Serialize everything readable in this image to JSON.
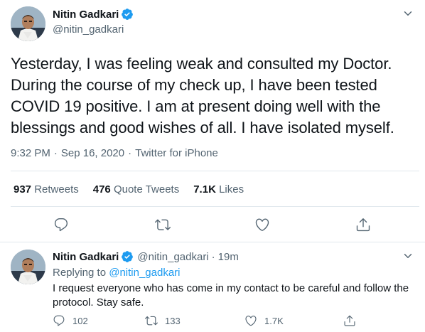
{
  "colors": {
    "accent": "#1d9bf0",
    "text_primary": "#0f1419",
    "text_secondary": "#536471",
    "divider": "#e1e8ed"
  },
  "main_tweet": {
    "author_name": "Nitin Gadkari",
    "handle": "@nitin_gadkari",
    "text": "Yesterday, I was feeling weak and consulted my Doctor. During the course of my check up, I have been tested COVID 19 positive. I am at present doing well with the blessings and good wishes of all. I have isolated myself.",
    "time": "9:32 PM",
    "separator": "·",
    "date": "Sep 16, 2020",
    "source": "Twitter for iPhone",
    "stats": {
      "retweets_count": "937",
      "retweets_label": "Retweets",
      "quotes_count": "476",
      "quotes_label": "Quote Tweets",
      "likes_count": "7.1K",
      "likes_label": "Likes"
    },
    "actions": [
      "reply-icon",
      "retweet-icon",
      "like-icon",
      "share-icon"
    ]
  },
  "reply_tweet": {
    "author_name": "Nitin Gadkari",
    "handle": "@nitin_gadkari",
    "separator": "·",
    "time": "19m",
    "replying_prefix": "Replying to",
    "replying_to": "@nitin_gadkari",
    "text": "I request everyone who has come in my contact to be careful and follow the protocol. Stay safe.",
    "reply_count": "102",
    "retweet_count": "133",
    "like_count": "1.7K"
  }
}
